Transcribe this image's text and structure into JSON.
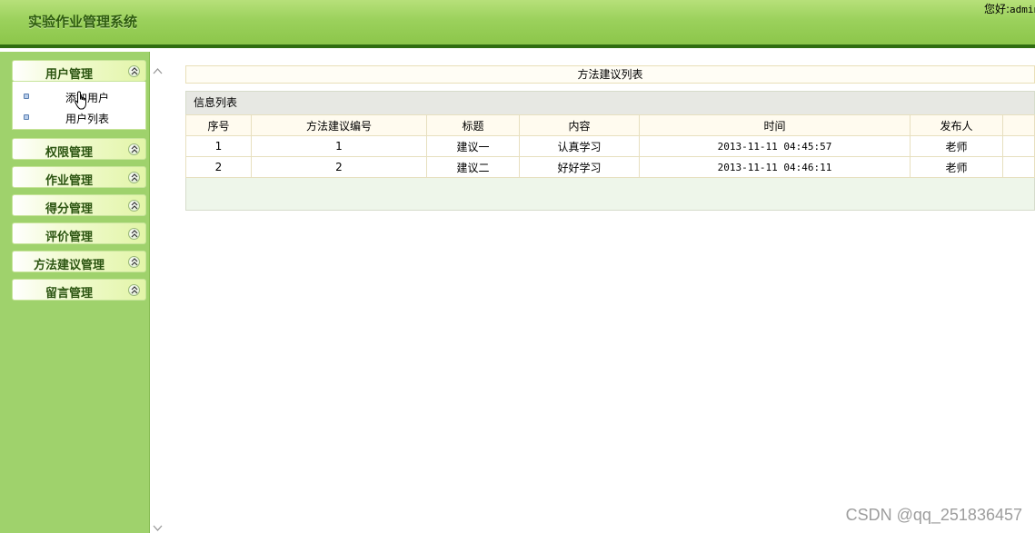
{
  "app": {
    "title": "实验作业管理系统"
  },
  "header": {
    "greeting": "您好:",
    "user": "admin"
  },
  "sidebar": {
    "groups": [
      {
        "label": "用户管理",
        "expanded": true,
        "items": [
          {
            "label": "添加用户"
          },
          {
            "label": "用户列表"
          }
        ]
      },
      {
        "label": "权限管理",
        "expanded": false
      },
      {
        "label": "作业管理",
        "expanded": false
      },
      {
        "label": "得分管理",
        "expanded": false
      },
      {
        "label": "评价管理",
        "expanded": false
      },
      {
        "label": "方法建议管理",
        "expanded": false
      },
      {
        "label": "留言管理",
        "expanded": false
      }
    ]
  },
  "main": {
    "page_title": "方法建议列表",
    "panel_title": "信息列表",
    "columns": [
      "序号",
      "方法建议编号",
      "标题",
      "内容",
      "时间",
      "发布人",
      ""
    ],
    "rows": [
      [
        "1",
        "1",
        "建议一",
        "认真学习",
        "2013-11-11 04:45:57",
        "老师",
        ""
      ],
      [
        "2",
        "2",
        "建议二",
        "好好学习",
        "2013-11-11 04:46:11",
        "老师",
        ""
      ]
    ]
  },
  "watermark": "CSDN @qq_251836457",
  "colors": {
    "header_green": "#9bd15c",
    "header_border": "#2f6d10",
    "sidebar_green": "#9fd26c",
    "title_text": "#2f5d10"
  },
  "icons": {
    "collapse_toggle": "double-chevron-up-icon",
    "sub_item_bullet": "square-bullet-icon",
    "cursor": "hand-pointer-icon",
    "scroll_up": "chevron-up-icon",
    "scroll_down": "chevron-down-icon"
  }
}
